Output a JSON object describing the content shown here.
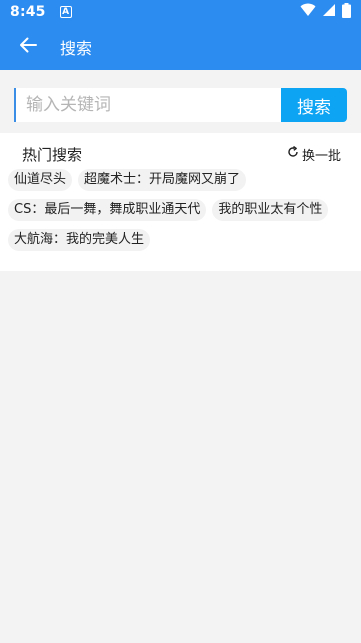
{
  "status_bar": {
    "time": "8:45",
    "notification_badge": "A"
  },
  "app_bar": {
    "title": "搜索"
  },
  "search": {
    "placeholder": "输入关键词",
    "value": "",
    "button_label": "搜索"
  },
  "hot": {
    "title": "热门搜索",
    "refresh_label": "换一批",
    "tags": [
      "仙道尽头",
      "超魔术士：开局魔网又崩了",
      "CS：最后一舞，舞成职业通天代",
      "我的职业太有个性",
      "大航海：我的完美人生"
    ]
  },
  "colors": {
    "primary": "#2d8cf0",
    "search_button": "#0da4f4",
    "background": "#f3f3f3"
  },
  "icons": {
    "back": "arrow-left-icon",
    "refresh": "refresh-icon",
    "wifi": "wifi-icon",
    "signal": "signal-icon",
    "battery": "battery-icon"
  }
}
